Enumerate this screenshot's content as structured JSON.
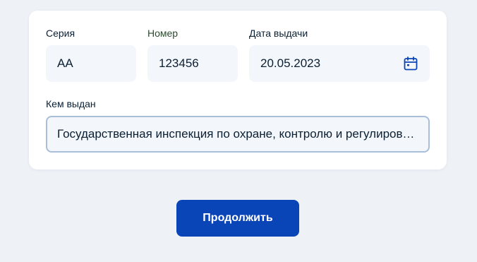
{
  "form": {
    "series": {
      "label": "Серия",
      "value": "AA"
    },
    "number": {
      "label": "Номер",
      "value": "123456"
    },
    "issue_date": {
      "label": "Дата выдачи",
      "value": "20.05.2023",
      "icon": "calendar-icon"
    },
    "issued_by": {
      "label": "Кем выдан",
      "value": "Государственная инспекция по охране, контролю и регулированию использования животного мира"
    }
  },
  "actions": {
    "continue_label": "Продолжить"
  },
  "colors": {
    "background": "#eef2f7",
    "card": "#ffffff",
    "input_bg": "#f3f6fa",
    "active_border": "#a9bedb",
    "primary": "#0a45b8",
    "icon": "#0a45b8",
    "text": "#0b1f33"
  }
}
